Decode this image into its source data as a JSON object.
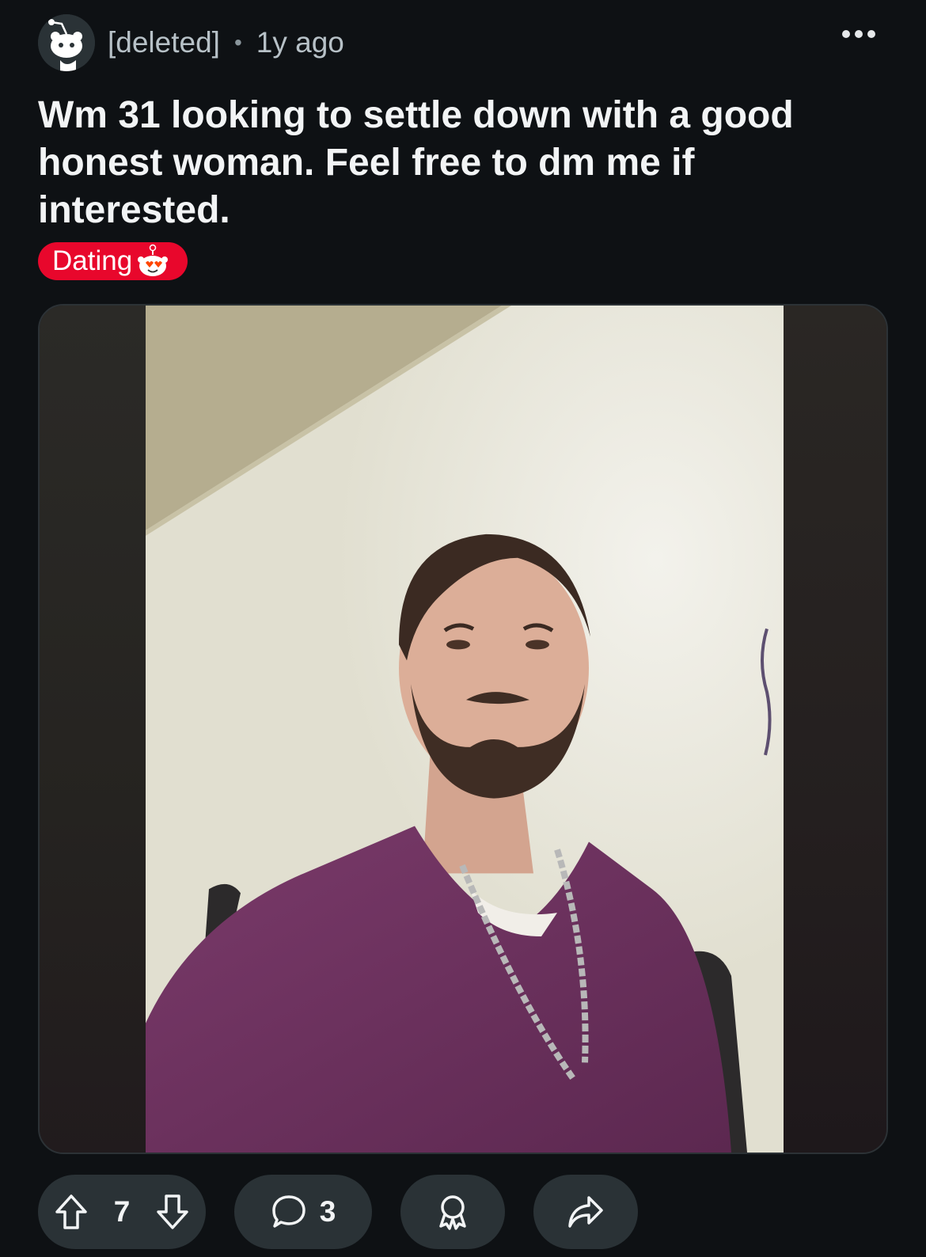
{
  "post": {
    "author": "[deleted]",
    "separator": "•",
    "age": "1y ago",
    "title": "Wm 31 looking to settle down with a good honest woman. Feel free to dm me if interested.",
    "flair": {
      "label": "Dating",
      "color": "#e8072c",
      "emoji": "heart-eyes-snoo-icon"
    }
  },
  "media": {
    "type": "photo",
    "description_icon": "selfie-photo"
  },
  "actions": {
    "upvote_icon": "arrow-up-icon",
    "score": "7",
    "downvote_icon": "arrow-down-icon",
    "comment_icon": "comment-bubble-icon",
    "comments": "3",
    "award_icon": "award-icon",
    "share_icon": "share-arrow-icon"
  },
  "colors": {
    "background": "#0e1114",
    "pill": "#2a3236",
    "text": "#f2f4f5",
    "muted": "#b7c1c7"
  }
}
